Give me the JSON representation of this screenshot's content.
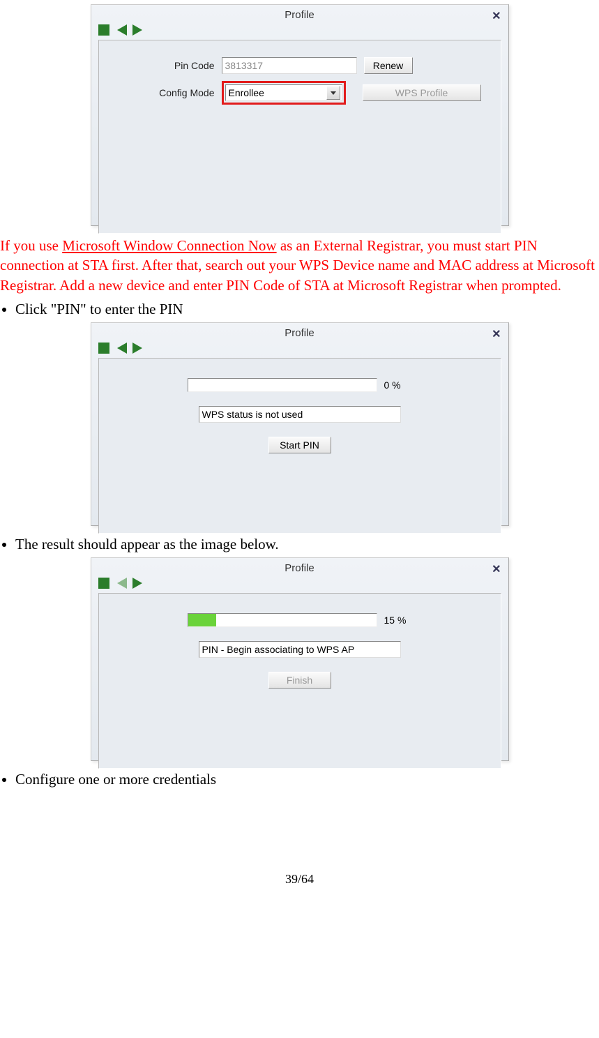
{
  "dialog1": {
    "title": "Profile",
    "pin_label": "Pin Code",
    "pin_value": "3813317",
    "renew_label": "Renew",
    "config_label": "Config Mode",
    "config_value": "Enrollee",
    "wps_label": "WPS Profile"
  },
  "red_paragraph": {
    "prefix": "If you use ",
    "link": "Microsoft Window Connection Now",
    "rest": " as an External Registrar, you must start PIN connection at STA first. After that, search out your WPS Device name and MAC address at Microsoft Registrar. Add a new device and enter PIN Code of STA at Microsoft Registrar when prompted."
  },
  "bullet1": "Click \"PIN\" to enter the PIN",
  "dialog2": {
    "title": "Profile",
    "pct": "0 %",
    "pct_value": 0,
    "status": "WPS status is not used",
    "btn": "Start PIN"
  },
  "bullet2": "The result should appear as the image below.",
  "dialog3": {
    "title": "Profile",
    "pct": "15 %",
    "pct_value": 15,
    "status": "PIN - Begin associating to WPS AP",
    "btn": "Finish"
  },
  "bullet3": "Configure one or more credentials",
  "page_number": "39/64"
}
